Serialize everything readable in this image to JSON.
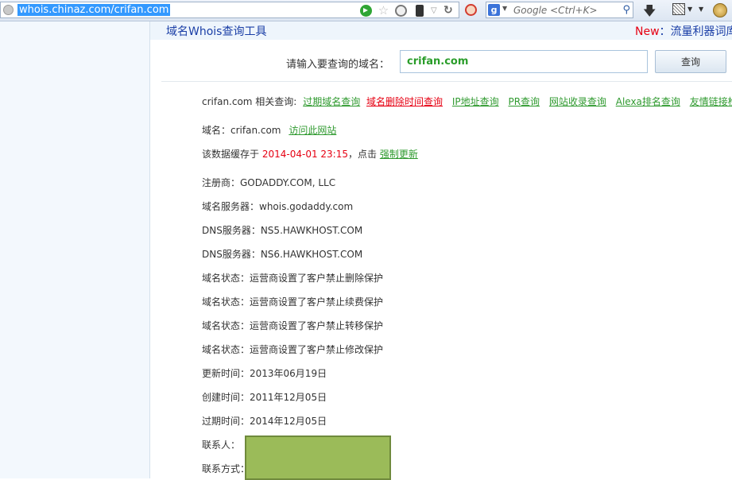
{
  "browser": {
    "url": "whois.chinaz.com/crifan.com",
    "search_placeholder": "Google <Ctrl+K>"
  },
  "header": {
    "tool_title": "域名Whois查询工具",
    "new_label": "New",
    "new_text": "：流量利器词库"
  },
  "search": {
    "prompt": "请输入要查询的域名：",
    "value": "crifan.com",
    "button_label": "查询"
  },
  "related": {
    "prefix": "crifan.com 相关查询:",
    "links": [
      {
        "label": "过期域名查询"
      },
      {
        "label": "域名删除时间查询"
      },
      {
        "label": "IP地址查询"
      },
      {
        "label": "PR查询"
      },
      {
        "label": "网站收录查询"
      },
      {
        "label": "Alexa排名查询"
      },
      {
        "label": "友情链接检测"
      }
    ]
  },
  "domain": {
    "label": "域名：crifan.com",
    "visit_link": "访问此网站"
  },
  "cache": {
    "prefix": "该数据缓存于",
    "time": "2014-04-01 23:15",
    "middle": "，点击",
    "refresh_link": "强制更新"
  },
  "records": [
    "注册商：GODADDY.COM, LLC",
    "域名服务器：whois.godaddy.com",
    "DNS服务器：NS5.HAWKHOST.COM",
    "DNS服务器：NS6.HAWKHOST.COM",
    "域名状态：运营商设置了客户禁止删除保护",
    "域名状态：运营商设置了客户禁止续费保护",
    "域名状态：运营商设置了客户禁止转移保护",
    "域名状态：运营商设置了客户禁止修改保护",
    "更新时间：2013年06月19日",
    "创建时间：2011年12月05日",
    "过期时间：2014年12月05日",
    "联系人：",
    "联系方式："
  ],
  "colors": {
    "link_green": "#2f9a2f",
    "accent_red": "#e60012",
    "title_blue": "#1a3ea6",
    "redaction": "#9bbb59"
  }
}
